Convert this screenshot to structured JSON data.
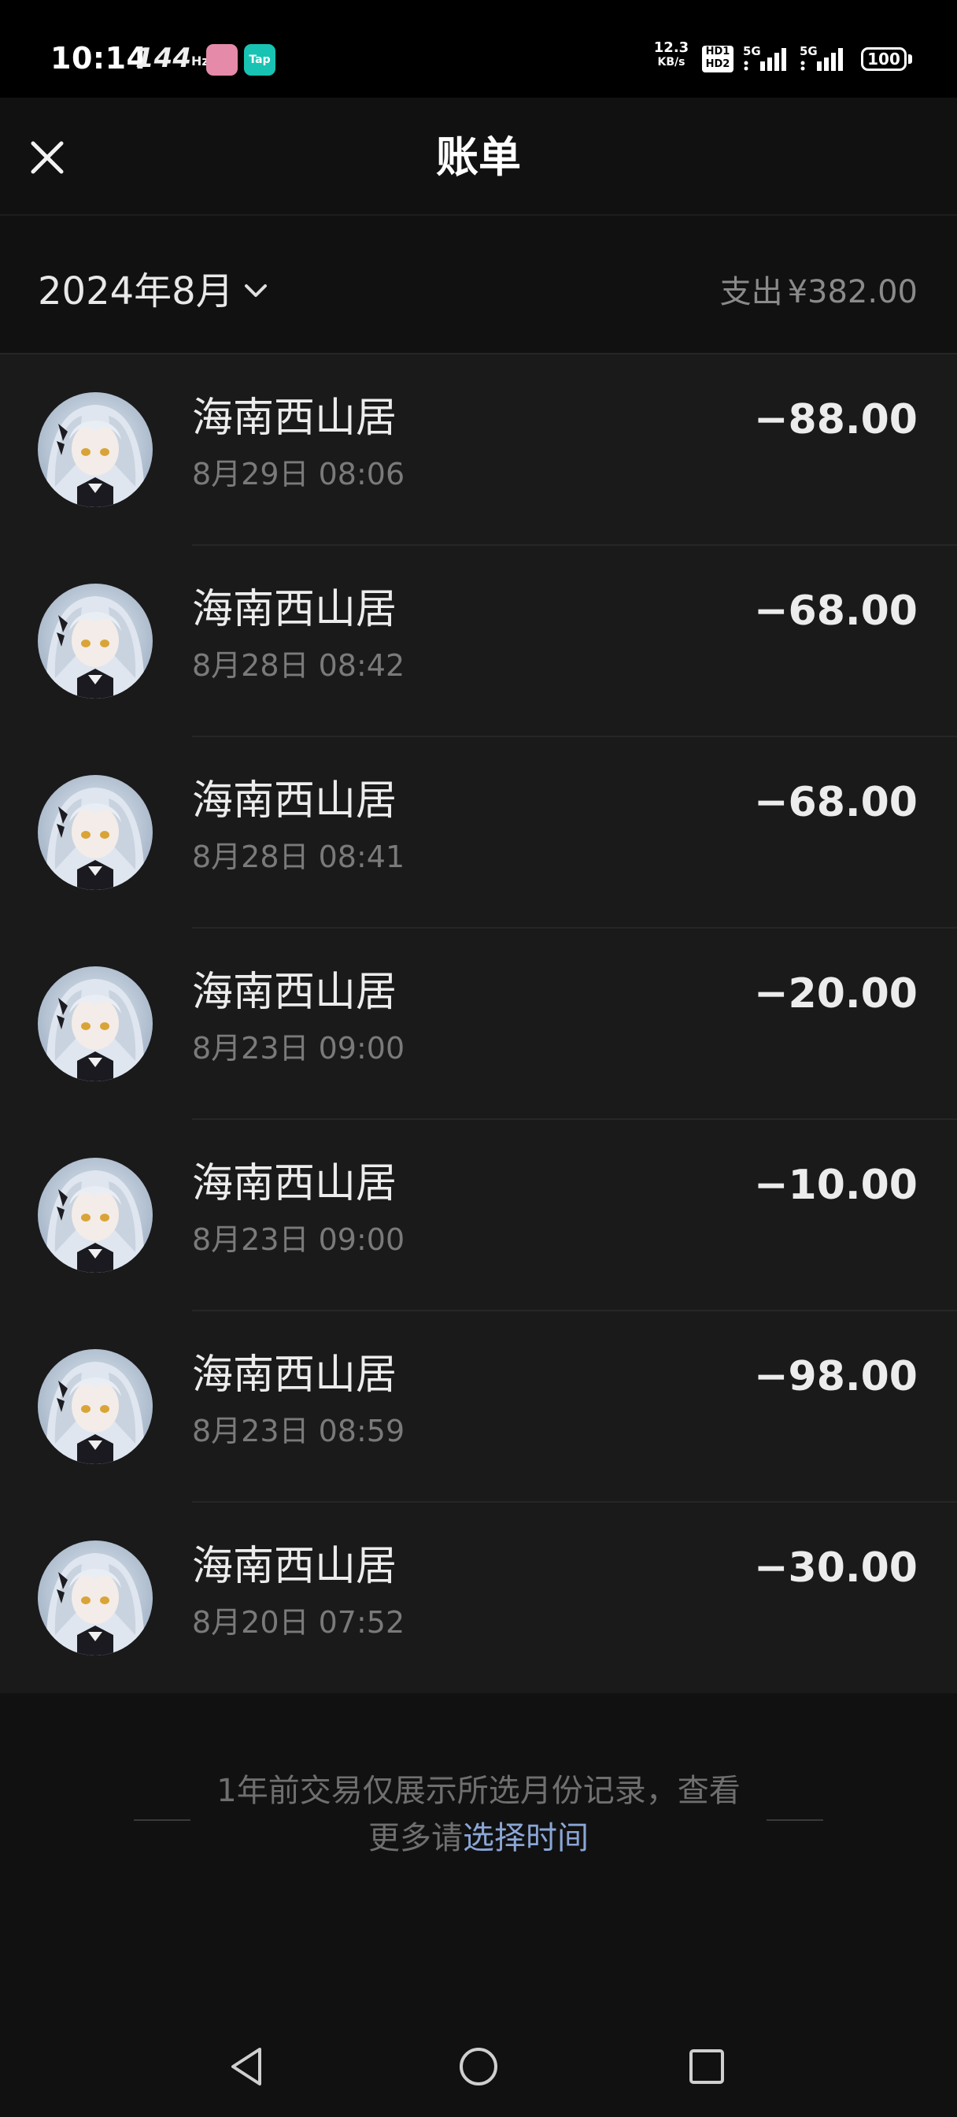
{
  "status_bar": {
    "time": "10:14",
    "refresh_rate": "144",
    "refresh_unit": "Hz",
    "net_speed_value": "12.3",
    "net_speed_unit": "KB/s",
    "hd_top": "HD1",
    "hd_bottom": "HD2",
    "signal1_label": "5G",
    "signal2_label": "5G",
    "battery": "100",
    "app_icon_tap": "Tap"
  },
  "header": {
    "title": "账单",
    "close_icon": "close-icon"
  },
  "summary": {
    "month": "2024年8月",
    "spend_label": "支出",
    "spend_amount": "¥382.00"
  },
  "transactions": [
    {
      "merchant": "海南西山居",
      "datetime": "8月29日 08:06",
      "amount": "−88.00"
    },
    {
      "merchant": "海南西山居",
      "datetime": "8月28日 08:42",
      "amount": "−68.00"
    },
    {
      "merchant": "海南西山居",
      "datetime": "8月28日 08:41",
      "amount": "−68.00"
    },
    {
      "merchant": "海南西山居",
      "datetime": "8月23日 09:00",
      "amount": "−20.00"
    },
    {
      "merchant": "海南西山居",
      "datetime": "8月23日 09:00",
      "amount": "−10.00"
    },
    {
      "merchant": "海南西山居",
      "datetime": "8月23日 08:59",
      "amount": "−98.00"
    },
    {
      "merchant": "海南西山居",
      "datetime": "8月20日 07:52",
      "amount": "−30.00"
    }
  ],
  "footer_note": {
    "text": "1年前交易仅展示所选月份记录，查看更多请",
    "link": "选择时间"
  },
  "colors": {
    "background": "#111111",
    "list_background": "#1a1a1a",
    "link": "#8aa6d6"
  }
}
